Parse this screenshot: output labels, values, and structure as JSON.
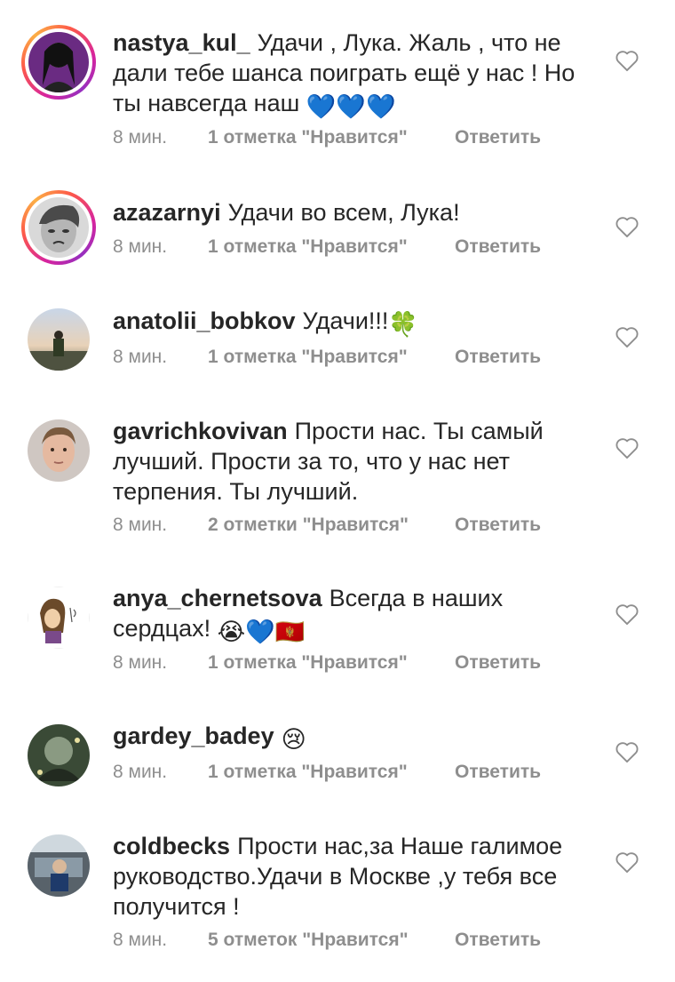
{
  "comments": [
    {
      "username": "nastya_kul_",
      "text": "Удачи , Лука. Жаль , что не дали тебе шанса поиграть ещё у нас ! Но ты навсегда наш",
      "emoji": "💙💙💙",
      "time": "8 мин.",
      "likes": "1 отметка \"Нравится\"",
      "reply": "Ответить",
      "avatar_ring": true
    },
    {
      "username": "azazarnyi",
      "text": "Удачи во всем, Лука!",
      "emoji": "",
      "time": "8 мин.",
      "likes": "1 отметка \"Нравится\"",
      "reply": "Ответить",
      "avatar_ring": true
    },
    {
      "username": "anatolii_bobkov",
      "text": "Удачи!!!",
      "emoji": "🍀",
      "time": "8 мин.",
      "likes": "1 отметка \"Нравится\"",
      "reply": "Ответить",
      "avatar_ring": false
    },
    {
      "username": "gavrichkovivan",
      "text": "Прости нас. Ты самый лучший. Прости за то, что у нас нет терпения. Ты лучший.",
      "emoji": "",
      "time": "8 мин.",
      "likes": "2 отметки \"Нравится\"",
      "reply": "Ответить",
      "avatar_ring": false
    },
    {
      "username": "anya_chernetsova",
      "text": "Всегда в наших сердцах!",
      "emoji": "😭💙🇲🇪",
      "time": "8 мин.",
      "likes": "1 отметка \"Нравится\"",
      "reply": "Ответить",
      "avatar_ring": false
    },
    {
      "username": "gardey_badey",
      "text": "",
      "emoji": "😢",
      "time": "8 мин.",
      "likes": "1 отметка \"Нравится\"",
      "reply": "Ответить",
      "avatar_ring": false
    },
    {
      "username": "coldbecks",
      "text": "Прости нас,за Наше галимое руководство.Удачи в Москве ,у тебя все получится !",
      "emoji": "",
      "time": "8 мин.",
      "likes": "5 отметок \"Нравится\"",
      "reply": "Ответить",
      "avatar_ring": false
    }
  ],
  "icons": {
    "like": "heart-outline-icon"
  },
  "colors": {
    "text": "#262626",
    "meta": "#8e8e8e",
    "heart_stroke": "#8e8e8e"
  }
}
